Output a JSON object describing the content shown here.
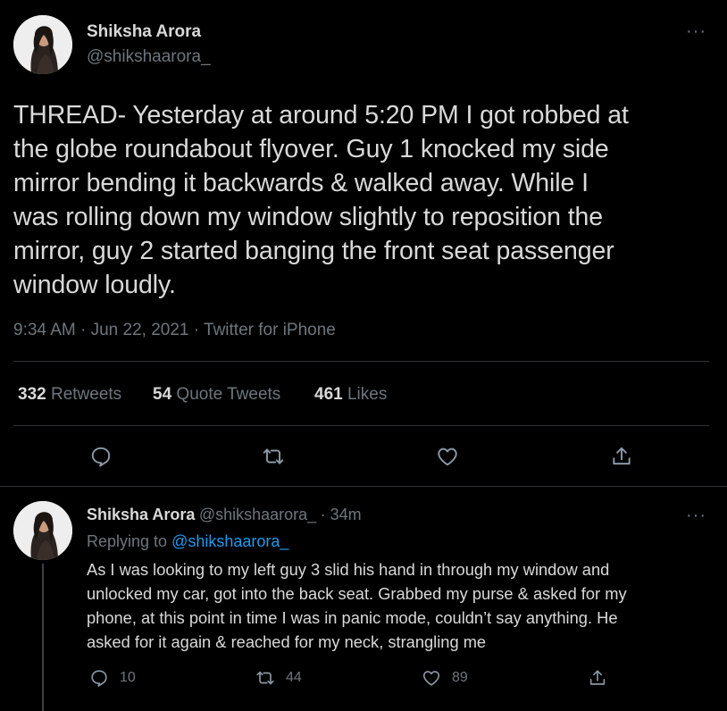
{
  "main_tweet": {
    "author_name": "Shiksha Arora",
    "author_handle": "@shikshaarora_",
    "more_glyph": "···",
    "text": "THREAD- Yesterday at around 5:20 PM I got robbed at\nthe globe roundabout flyover. Guy 1 knocked my side\nmirror bending it backwards & walked away. While I\nwas rolling down my window slightly to reposition the\nmirror, guy 2 started banging the front seat passenger\nwindow loudly.",
    "time": "9:34 AM",
    "date": "Jun 22, 2021",
    "source": "Twitter for iPhone",
    "separator": " · ",
    "stats": {
      "retweets_count": "332",
      "retweets_label": "Retweets",
      "quote_count": "54",
      "quote_label": "Quote Tweets",
      "likes_count": "461",
      "likes_label": "Likes"
    },
    "actions": [
      "reply-icon",
      "retweet-icon",
      "like-icon",
      "share-icon"
    ]
  },
  "reply_tweet": {
    "author_name": "Shiksha Arora",
    "author_handle": "@shikshaarora_",
    "time_ago": "· 34m",
    "more_glyph": "···",
    "replying_prefix": "Replying to ",
    "replying_to": "@shikshaarora_",
    "text": "As I was looking to my left guy 3 slid his hand in through my window and\nunlocked my car, got into the back seat. Grabbed my purse & asked for my\nphone, at this point in time I was in panic mode, couldn’t say anything. He\nasked for it again & reached for my neck, strangling me",
    "replies": "10",
    "retweets": "44",
    "likes": "89"
  },
  "colors": {
    "background": "#000000",
    "text": "#d9d9d9",
    "muted": "#6e767d",
    "link": "#1d9bf0",
    "divider": "#2f3336"
  }
}
